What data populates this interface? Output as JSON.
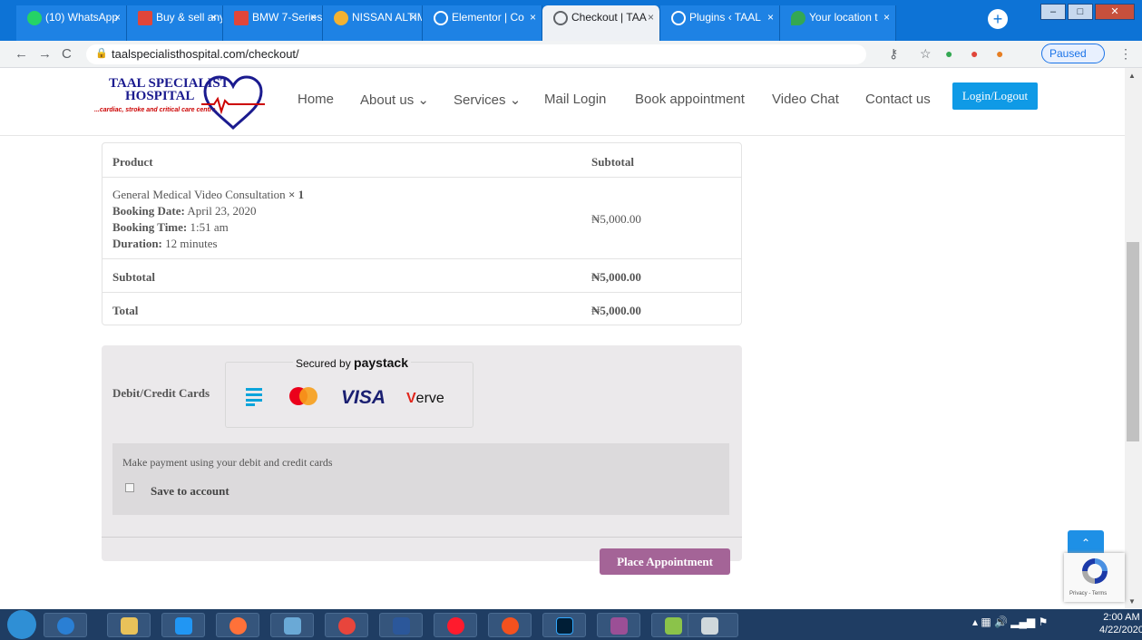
{
  "browser": {
    "tabs": [
      {
        "label": "(10) WhatsApp",
        "favicon": "whatsapp-icon",
        "color": "#25d366"
      },
      {
        "label": "Buy & sell any",
        "favicon": "flame-icon",
        "color": "#e0463a"
      },
      {
        "label": "BMW 7-Series",
        "favicon": "flame-icon",
        "color": "#e0463a"
      },
      {
        "label": "NISSAN ALTIM",
        "favicon": "bird-icon",
        "color": "#f2b233"
      },
      {
        "label": "Elementor | Co",
        "favicon": "globe-icon",
        "color": "#ffffff"
      },
      {
        "label": "Checkout | TAA",
        "favicon": "globe-icon",
        "color": "#5f6368"
      },
      {
        "label": "Plugins ‹ TAAL",
        "favicon": "globe-icon",
        "color": "#ffffff"
      },
      {
        "label": "Your location t",
        "favicon": "maps-pin-icon",
        "color": "#34a853"
      }
    ],
    "tab_close": "×",
    "new_tab": "+",
    "window_controls": {
      "minimize": "–",
      "maximize": "□",
      "close": "✕"
    },
    "nav": {
      "back": "←",
      "forward": "→",
      "reload": "C"
    },
    "url": "taalspecialisthospital.com/checkout/",
    "profile_status": "Paused"
  },
  "site": {
    "logo": {
      "line1": "TAAL SPECIALIST",
      "line2": "HOSPITAL",
      "tagline": "...cardiac, stroke and critical care centre."
    },
    "nav": [
      {
        "label": "Home",
        "dropdown": false
      },
      {
        "label": "About us",
        "dropdown": true
      },
      {
        "label": "Services",
        "dropdown": true
      },
      {
        "label": "Mail Login",
        "dropdown": false
      },
      {
        "label": "Book appointment",
        "dropdown": false
      },
      {
        "label": "Video Chat",
        "dropdown": false
      },
      {
        "label": "Contact us",
        "dropdown": false
      }
    ],
    "dropdown_glyph": "⌄",
    "login_label": "Login/Logout"
  },
  "order": {
    "header_product": "Product",
    "header_subtotal": "Subtotal",
    "item": {
      "name": "General Medical Video Consultation",
      "qty": "× 1",
      "booking_date_label": "Booking Date:",
      "booking_date": "April 23, 2020",
      "booking_time_label": "Booking Time:",
      "booking_time": "1:51 am",
      "duration_label": "Duration:",
      "duration": "12 minutes",
      "price": "₦5,000.00"
    },
    "subtotal_label": "Subtotal",
    "subtotal_value": "₦5,000.00",
    "total_label": "Total",
    "total_value": "₦5,000.00"
  },
  "payment": {
    "method_label": "Debit/Credit Cards",
    "secured_prefix": "Secured by",
    "secured_brand": "paystack",
    "card_brands": [
      "VISA",
      "erve"
    ],
    "description": "Make payment using your debit and credit cards",
    "save_label": "Save to account",
    "place_button": "Place Appointment"
  },
  "page_ui": {
    "to_top": "⌃",
    "recaptcha_text": "Privacy - Terms"
  },
  "taskbar": {
    "time": "2:00 AM",
    "date": "4/22/2020"
  }
}
